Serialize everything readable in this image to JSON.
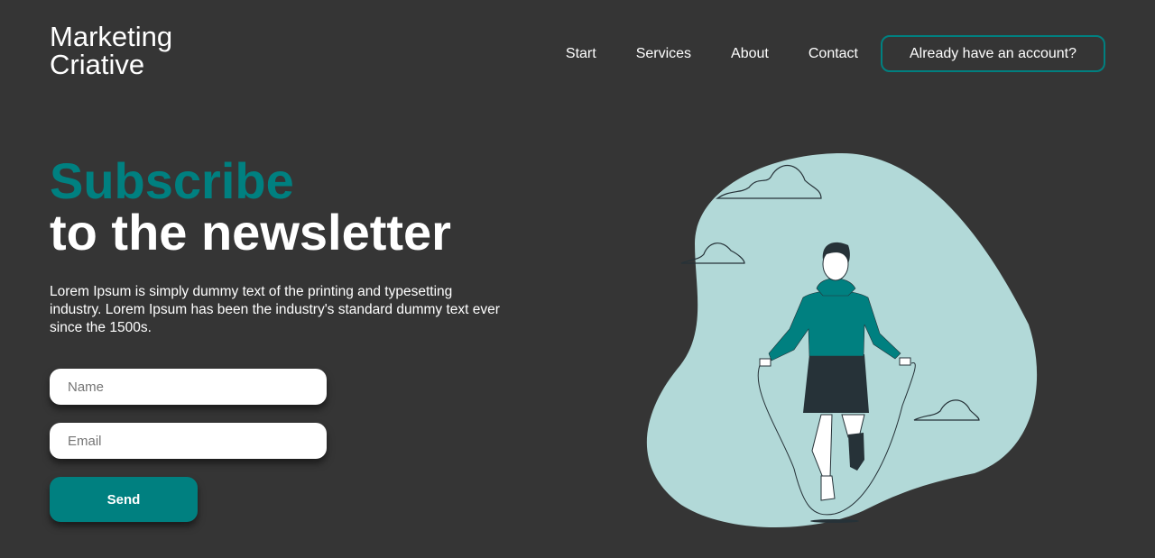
{
  "brand": {
    "line1": "Marketing",
    "line2": "Criative"
  },
  "nav": {
    "items": [
      "Start",
      "Services",
      "About",
      "Contact"
    ],
    "account_button": "Already have an account?"
  },
  "hero": {
    "title_accent": "Subscribe",
    "title_rest": "to the newsletter",
    "description": "Lorem Ipsum is simply dummy text of the printing and typesetting industry. Lorem Ipsum has been the industry's standard dummy text ever since the 1500s."
  },
  "form": {
    "name_placeholder": "Name",
    "email_placeholder": "Email",
    "send_label": "Send"
  },
  "colors": {
    "background": "#353535",
    "accent": "#008080",
    "blob": "#b2d9d8"
  },
  "illustration": "man-jumping-rope-illustration"
}
